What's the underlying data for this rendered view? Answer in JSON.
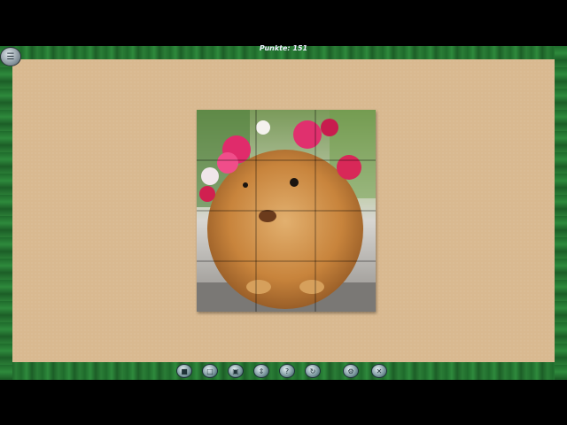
{
  "hud": {
    "score_text": "Punkte: 151"
  },
  "menu": {
    "icon": "menu-icon"
  },
  "puzzle": {
    "image": "guinea pig with flower crown",
    "state": "assembled with piece outlines visible"
  },
  "toolbar": {
    "buttons": [
      {
        "name": "tool-button-1",
        "icon": "box-icon"
      },
      {
        "name": "tool-button-2",
        "icon": "ghost-image-icon"
      },
      {
        "name": "tool-button-3",
        "icon": "edge-pieces-icon"
      },
      {
        "name": "tool-button-4",
        "icon": "sort-icon"
      },
      {
        "name": "tool-button-5",
        "icon": "hint-icon"
      },
      {
        "name": "tool-button-6",
        "icon": "rotate-icon"
      },
      {
        "name": "tool-button-7",
        "icon": "settings-icon"
      },
      {
        "name": "tool-button-8",
        "icon": "exit-icon"
      }
    ]
  },
  "colors": {
    "board": "#d9b990",
    "frame": "#2a7d36"
  }
}
